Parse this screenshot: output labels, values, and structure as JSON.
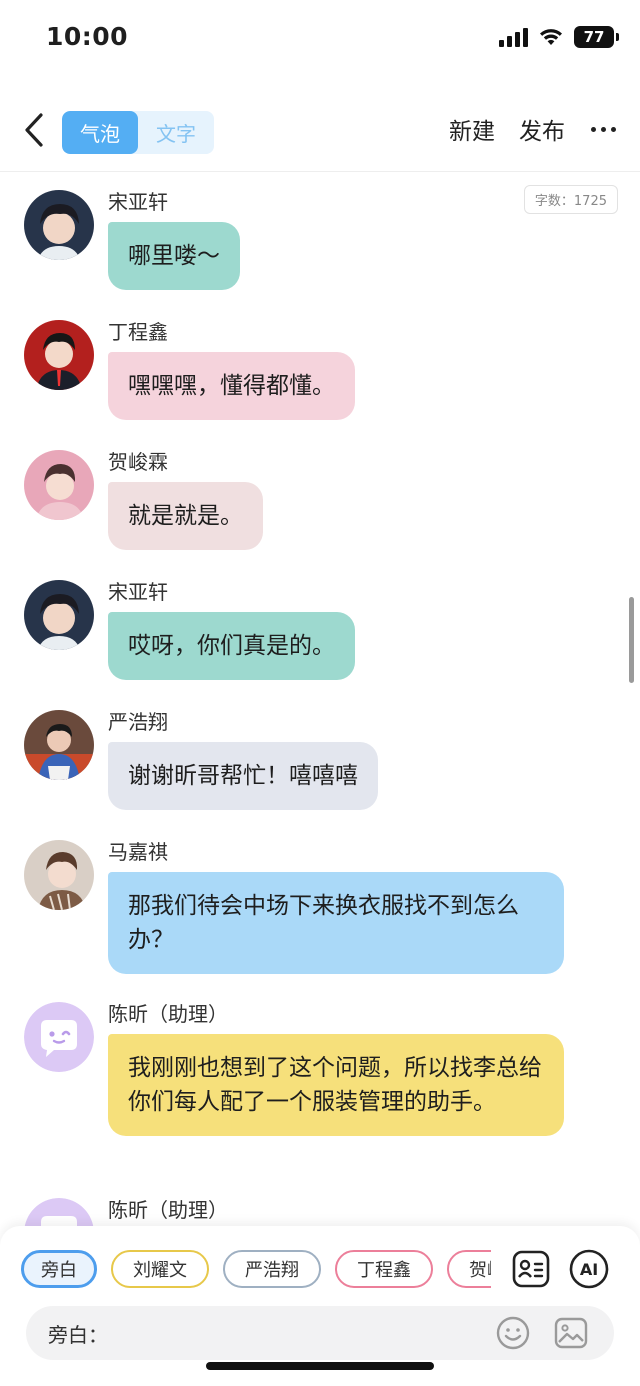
{
  "status_bar": {
    "time": "10:00",
    "battery": "77"
  },
  "nav": {
    "tabs": [
      {
        "label": "气泡",
        "active": true
      },
      {
        "label": "文字",
        "active": false
      }
    ],
    "new_label": "新建",
    "publish_label": "发布"
  },
  "word_count": "字数：1725",
  "messages": [
    {
      "speaker": "宋亚轩",
      "text": "哪里喽～",
      "bubble_color": "#9dd9cf"
    },
    {
      "speaker": "丁程鑫",
      "text": "嘿嘿嘿，懂得都懂。",
      "bubble_color": "#f5d3dc"
    },
    {
      "speaker": "贺峻霖",
      "text": "就是就是。",
      "bubble_color": "#f0dfe0"
    },
    {
      "speaker": "宋亚轩",
      "text": "哎呀，你们真是的。",
      "bubble_color": "#9dd9cf"
    },
    {
      "speaker": "严浩翔",
      "text": "谢谢昕哥帮忙！嘻嘻嘻",
      "bubble_color": "#e3e6ee"
    },
    {
      "speaker": "马嘉祺",
      "text": "那我们待会中场下来换衣服找不到怎么办？",
      "bubble_color": "#aad9f8"
    },
    {
      "speaker": "陈昕（助理）",
      "text": "我刚刚也想到了这个问题，所以找李总给你们每人配了一个服装管理的助手。",
      "bubble_color": "#f6e07b"
    },
    {
      "speaker": "陈昕（助理）",
      "text": "",
      "bubble_color": ""
    }
  ],
  "roles": [
    "旁白",
    "刘耀文",
    "严浩翔",
    "丁程鑫",
    "贺峻霖"
  ],
  "input": {
    "label": "旁白：",
    "value": ""
  },
  "icons": {
    "back": "chevron-left-icon",
    "more": "more-dots-icon",
    "role_card": "role-card-icon",
    "ai": "ai-icon",
    "emoji": "emoji-icon",
    "image": "image-icon"
  }
}
